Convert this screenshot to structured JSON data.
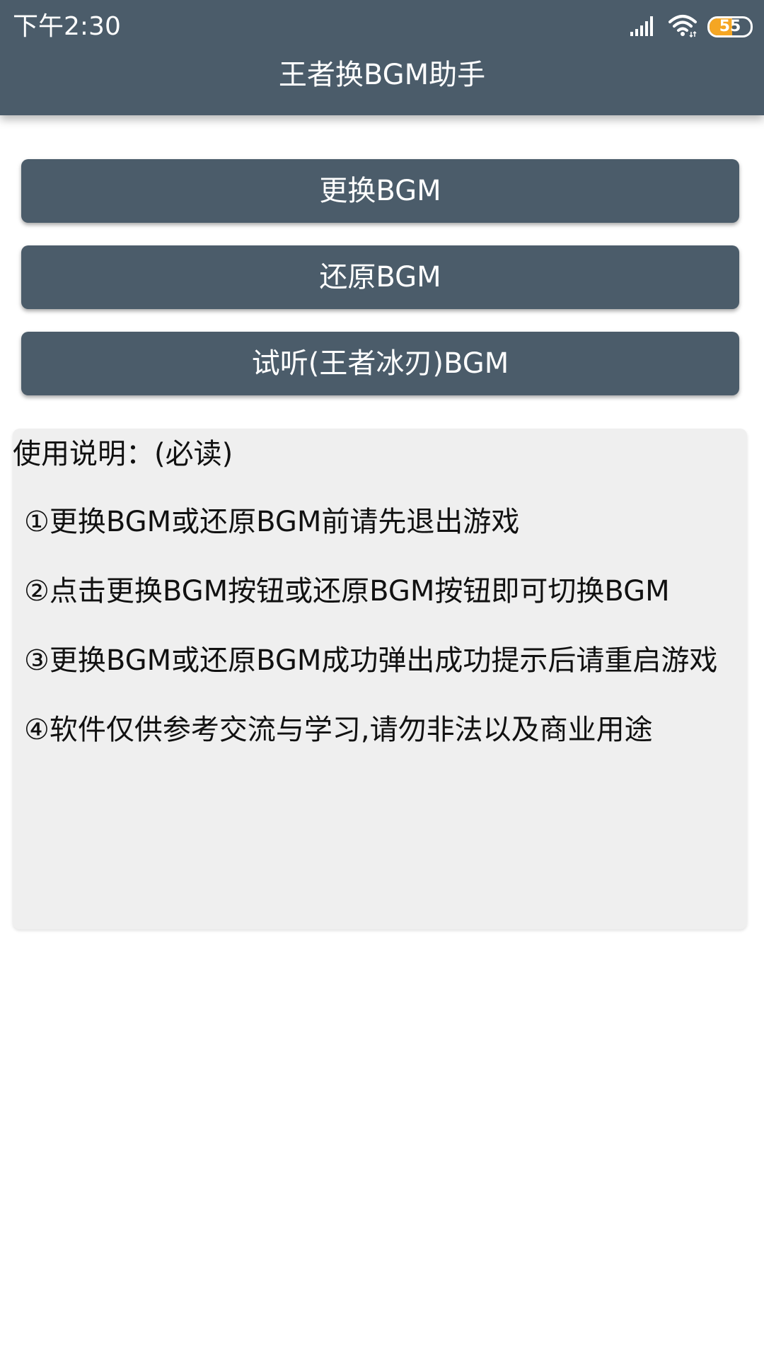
{
  "status_bar": {
    "time": "下午2:30",
    "battery_level": "55",
    "battery_fraction": 0.55,
    "icons": [
      "signal-icon",
      "wifi-icon",
      "battery-icon"
    ]
  },
  "app_bar": {
    "title": "王者换BGM助手"
  },
  "buttons": {
    "replace": "更换BGM",
    "restore": "还原BGM",
    "preview": "试听(王者冰刃)BGM"
  },
  "instructions": {
    "title": "使用说明：(必读)",
    "items": [
      "①更换BGM或还原BGM前请先退出游戏",
      "②点击更换BGM按钮或还原BGM按钮即可切换BGM",
      "③更换BGM或还原BGM成功弹出成功提示后请重启游戏",
      "④软件仅供参考交流与学习,请勿非法以及商业用途"
    ]
  },
  "colors": {
    "primary": "#4b5c6a",
    "panel": "#efefef",
    "battery": "#f5a623"
  }
}
